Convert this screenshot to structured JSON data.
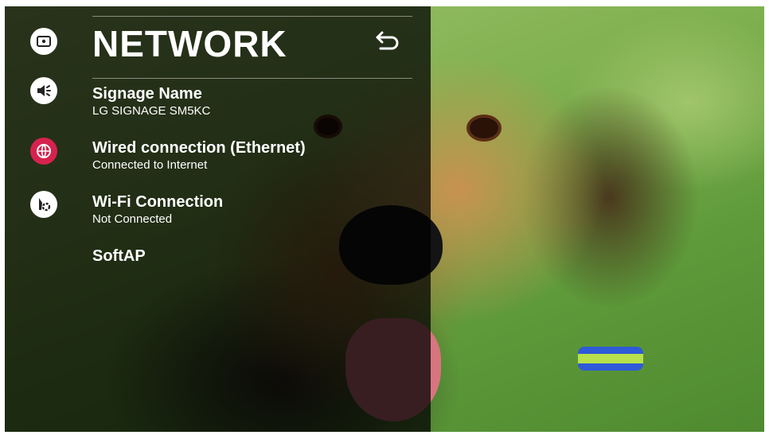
{
  "screen": {
    "title": "NETWORK",
    "back_icon": "back-arrow-icon",
    "accent_color": "#d6224e"
  },
  "sidebar": {
    "items": [
      {
        "icon": "picture-icon",
        "active": false
      },
      {
        "icon": "sound-icon",
        "active": false
      },
      {
        "icon": "network-globe-icon",
        "active": true
      },
      {
        "icon": "general-settings-icon",
        "active": false
      }
    ]
  },
  "menu": {
    "items": [
      {
        "label": "Signage Name",
        "value": "LG SIGNAGE SM5KC"
      },
      {
        "label": "Wired connection (Ethernet)",
        "value": "Connected to Internet"
      },
      {
        "label": "Wi-Fi Connection",
        "value": "Not Connected"
      },
      {
        "label": "SoftAP",
        "value": ""
      }
    ]
  }
}
